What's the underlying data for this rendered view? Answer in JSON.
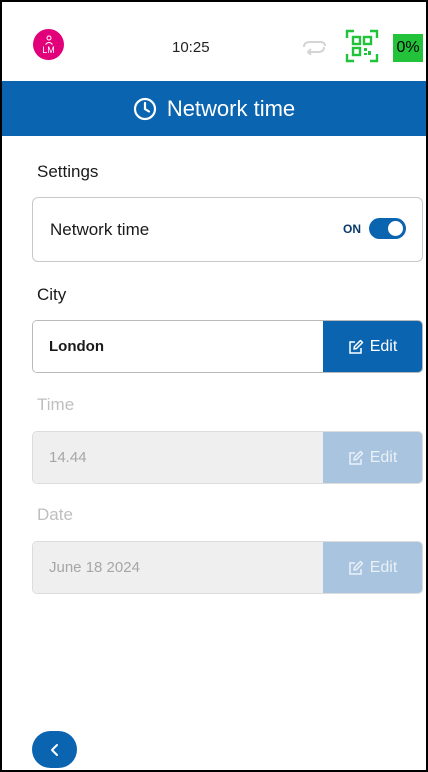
{
  "status_bar": {
    "avatar_initials": "LM",
    "time": "10:25",
    "battery": "0%",
    "colors": {
      "avatar": "#e2007a",
      "battery": "#22c33b",
      "qr": "#22c33b"
    },
    "icons": [
      "person-icon",
      "sync-icon",
      "qr-code-icon"
    ]
  },
  "header": {
    "title": "Network time",
    "icon": "clock-icon",
    "color": "#0a64b0"
  },
  "settings": {
    "section_label": "Settings",
    "network_time_label": "Network time",
    "toggle_state": "ON"
  },
  "city": {
    "section_label": "City",
    "value": "London",
    "edit_label": "Edit"
  },
  "time": {
    "section_label": "Time",
    "value": "14.44",
    "edit_label": "Edit",
    "disabled": true
  },
  "date": {
    "section_label": "Date",
    "value": "June 18 2024",
    "edit_label": "Edit",
    "disabled": true
  },
  "footer": {
    "back_icon": "chevron-left-icon"
  }
}
